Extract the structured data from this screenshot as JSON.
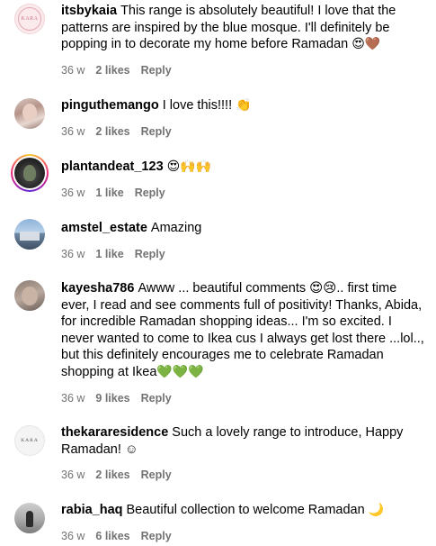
{
  "comments": [
    {
      "username": "itsbykaia",
      "text": "This range is absolutely beautiful! I love that the patterns are inspired by the blue mosque. I'll definitely be popping in to decorate my home before Ramadan",
      "emojis": "😍🤎",
      "time": "36 w",
      "likes": "2 likes",
      "reply": "Reply",
      "avatar_text": "KARA",
      "avatar_icon": "kara-logo-avatar"
    },
    {
      "username": "pinguthemango",
      "text": "I love this!!!!",
      "emojis": "👏",
      "time": "36 w",
      "likes": "2 likes",
      "reply": "Reply",
      "avatar_icon": "user-photo-avatar"
    },
    {
      "username": "plantandeat_123",
      "text": "",
      "emojis": "😍🙌🙌",
      "time": "36 w",
      "likes": "1 like",
      "reply": "Reply",
      "avatar_icon": "story-ring-avatar"
    },
    {
      "username": "amstel_estate",
      "text": "Amazing",
      "emojis": "",
      "time": "36 w",
      "likes": "1 like",
      "reply": "Reply",
      "avatar_icon": "house-photo-avatar"
    },
    {
      "username": "kayesha786",
      "text": "Awww ... beautiful comments 😍😢.. first time ever, I read and see comments full of positivity! Thanks, Abida, for incredible Ramadan shopping ideas... I'm so excited. I never wanted to come to Ikea cus I always get lost there ...lol.., but this definitely encourages me to celebrate Ramadan shopping at Ikea",
      "emojis": "💚💚💚",
      "time": "36 w",
      "likes": "9 likes",
      "reply": "Reply",
      "avatar_icon": "user-photo-avatar"
    },
    {
      "username": "thekararesidence",
      "text": "Such a lovely range to introduce, Happy Ramadan! ☺",
      "emojis": "",
      "time": "36 w",
      "likes": "2 likes",
      "reply": "Reply",
      "avatar_text": "KARA",
      "avatar_icon": "kara-logo-avatar"
    },
    {
      "username": "rabia_haq",
      "text": "Beautiful collection to welcome Ramadan",
      "emojis": "🌙",
      "time": "36 w",
      "likes": "6 likes",
      "reply": "Reply",
      "avatar_icon": "user-photo-avatar"
    }
  ]
}
